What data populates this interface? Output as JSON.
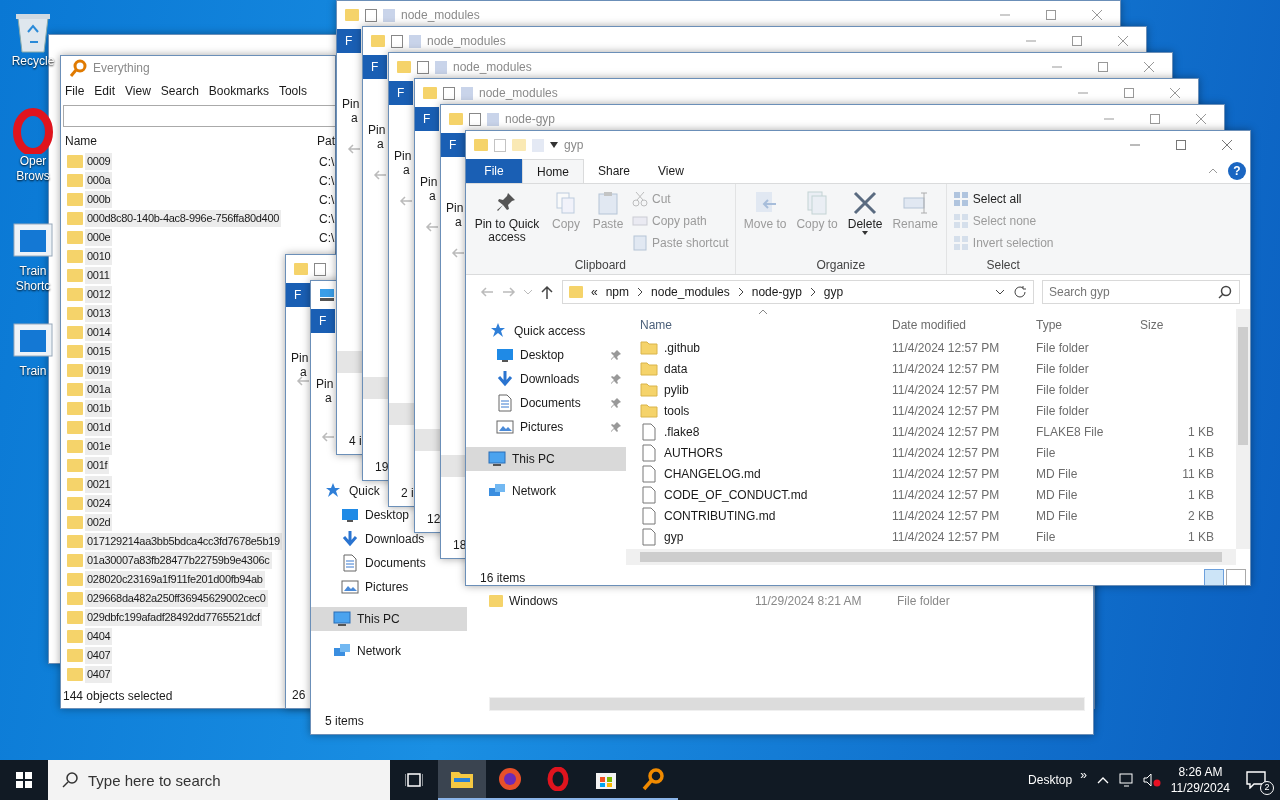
{
  "desktop_icons": [
    {
      "lines": [
        "Recycle"
      ]
    },
    {
      "lines": [
        "Oper",
        "Brows"
      ]
    },
    {
      "lines": [
        "Train",
        "Shortc"
      ]
    },
    {
      "lines": [
        "Train"
      ]
    }
  ],
  "everything_window": {
    "title": "Everything",
    "menu": [
      "File",
      "Edit",
      "View",
      "Search",
      "Bookmarks",
      "Tools"
    ],
    "columns": [
      "Name",
      "Pat"
    ],
    "rows": [
      {
        "name": "0009",
        "path": "C:\\",
        "selected": true
      },
      {
        "name": "000a",
        "path": "C:\\",
        "selected": true
      },
      {
        "name": "000b",
        "path": "C:\\",
        "selected": true
      },
      {
        "name": "000d8c80-140b-4ac8-996e-756ffa80d400",
        "path": "C:\\",
        "selected": true
      },
      {
        "name": "000e",
        "path": "C:\\",
        "selected": true
      },
      {
        "name": "0010",
        "selected": true
      },
      {
        "name": "0011",
        "selected": true
      },
      {
        "name": "0012",
        "selected": true
      },
      {
        "name": "0013",
        "selected": true
      },
      {
        "name": "0014",
        "selected": true
      },
      {
        "name": "0015",
        "selected": true
      },
      {
        "name": "0019",
        "selected": true
      },
      {
        "name": "001a",
        "selected": true
      },
      {
        "name": "001b",
        "selected": true
      },
      {
        "name": "001d",
        "selected": true
      },
      {
        "name": "001e",
        "selected": true
      },
      {
        "name": "001f",
        "selected": true
      },
      {
        "name": "0021",
        "selected": true
      },
      {
        "name": "0024",
        "selected": true
      },
      {
        "name": "002d",
        "selected": true
      },
      {
        "name": "017129214aa3bb5bdca4cc3fd7678e5b19",
        "selected": true
      },
      {
        "name": "01a30007a83fb28477b22759b9e4306c",
        "selected": true
      },
      {
        "name": "028020c23169a1f911fe201d00fb94ab",
        "selected": true
      },
      {
        "name": "029668da482a250ff36945629002cec0",
        "selected": true
      },
      {
        "name": "029dbfc199afadf28492dd7765521dcf",
        "selected": true
      },
      {
        "name": "0404",
        "selected": true
      },
      {
        "name": "0407",
        "selected": true
      },
      {
        "name": "0407",
        "selected": true
      }
    ],
    "status": "144 objects selected"
  },
  "lower_windows": [
    {
      "file_tab": "F",
      "pin_lines": [
        "Pin",
        "a"
      ],
      "status": "26"
    },
    {
      "file_tab": "F",
      "pin_lines": [
        "Pin",
        "a"
      ],
      "nav": [
        {
          "label": "Quick",
          "kind": "star",
          "selected": false
        },
        {
          "label": "Desktop",
          "kind": "desktop",
          "selected": false
        },
        {
          "label": "Downloads",
          "kind": "download",
          "selected": false
        },
        {
          "label": "Documents",
          "kind": "document",
          "selected": false
        },
        {
          "label": "Pictures",
          "kind": "picture",
          "selected": false
        },
        {
          "label": "This PC",
          "kind": "pc",
          "selected": true
        },
        {
          "label": "Network",
          "kind": "network",
          "selected": false
        }
      ],
      "row": {
        "name": "Windows",
        "date": "11/29/2024 8:21 AM",
        "type": "File folder"
      },
      "status": "5 items"
    }
  ],
  "stacked_windows": [
    {
      "title": "node_modules",
      "file_tab": "F",
      "pin_lines": [
        "Pin",
        "a"
      ],
      "status": "4 i"
    },
    {
      "title": "node_modules",
      "file_tab": "F",
      "pin_lines": [
        "Pin",
        "a"
      ],
      "status": "19"
    },
    {
      "title": "node_modules",
      "file_tab": "F",
      "pin_lines": [
        "Pin",
        "a"
      ],
      "status": "2 i"
    },
    {
      "title": "node_modules",
      "file_tab": "F",
      "pin_lines": [
        "Pin",
        "a"
      ],
      "status": "12"
    },
    {
      "title": "node-gyp",
      "file_tab": "F",
      "pin_lines": [
        "Pin",
        "a"
      ],
      "status": "18"
    }
  ],
  "explorer": {
    "title": "gyp",
    "tabs": [
      {
        "label": "File",
        "kind": "file",
        "selected": false
      },
      {
        "label": "Home",
        "kind": "tab",
        "selected": true
      },
      {
        "label": "Share",
        "kind": "tab",
        "selected": false
      },
      {
        "label": "View",
        "kind": "tab",
        "selected": false
      }
    ],
    "help": "?",
    "ribbon_groups": [
      {
        "label": "Clipboard",
        "items": [
          {
            "kind": "large",
            "label": "Pin to Quick access",
            "disabled": false
          },
          {
            "kind": "large",
            "label": "Copy",
            "disabled": true
          },
          {
            "kind": "large",
            "label": "Paste",
            "disabled": true
          },
          {
            "kind": "small",
            "label": "Cut",
            "disabled": true
          },
          {
            "kind": "small",
            "label": "Copy path",
            "disabled": true
          },
          {
            "kind": "small",
            "label": "Paste shortcut",
            "disabled": true
          }
        ]
      },
      {
        "label": "Organize",
        "items": [
          {
            "kind": "large",
            "label": "Move to",
            "disabled": true
          },
          {
            "kind": "large",
            "label": "Copy to",
            "disabled": true
          },
          {
            "kind": "large",
            "label": "Delete",
            "disabled": false
          },
          {
            "kind": "large",
            "label": "Rename",
            "disabled": true
          }
        ]
      },
      {
        "label": "Select",
        "items": [
          {
            "kind": "small",
            "label": "Select all",
            "disabled": false
          },
          {
            "kind": "small",
            "label": "Select none",
            "disabled": true
          },
          {
            "kind": "small",
            "label": "Invert selection",
            "disabled": true
          }
        ]
      }
    ],
    "breadcrumbs": [
      "«",
      "npm",
      "node_modules",
      "node-gyp",
      "gyp"
    ],
    "search": {
      "placeholder": "Search gyp"
    },
    "nav": [
      {
        "label": "Quick access",
        "kind": "star",
        "pinned": false,
        "selected": false
      },
      {
        "label": "Desktop",
        "kind": "desktop",
        "pinned": true,
        "selected": false
      },
      {
        "label": "Downloads",
        "kind": "download",
        "pinned": true,
        "selected": false
      },
      {
        "label": "Documents",
        "kind": "document",
        "pinned": true,
        "selected": false
      },
      {
        "label": "Pictures",
        "kind": "picture",
        "pinned": true,
        "selected": false
      },
      {
        "label": "This PC",
        "kind": "pc",
        "pinned": false,
        "selected": true
      },
      {
        "label": "Network",
        "kind": "network",
        "pinned": false,
        "selected": false
      }
    ],
    "columns": [
      "Name",
      "Date modified",
      "Type",
      "Size"
    ],
    "files": [
      {
        "name": ".github",
        "kind": "folder",
        "date": "11/4/2024 12:57 PM",
        "type": "File folder"
      },
      {
        "name": "data",
        "kind": "folder",
        "date": "11/4/2024 12:57 PM",
        "type": "File folder"
      },
      {
        "name": "pylib",
        "kind": "folder",
        "date": "11/4/2024 12:57 PM",
        "type": "File folder"
      },
      {
        "name": "tools",
        "kind": "folder",
        "date": "11/4/2024 12:57 PM",
        "type": "File folder"
      },
      {
        "name": ".flake8",
        "kind": "file",
        "date": "11/4/2024 12:57 PM",
        "type": "FLAKE8 File",
        "size": "1 KB"
      },
      {
        "name": "AUTHORS",
        "kind": "file",
        "date": "11/4/2024 12:57 PM",
        "type": "File",
        "size": "1 KB"
      },
      {
        "name": "CHANGELOG.md",
        "kind": "file",
        "date": "11/4/2024 12:57 PM",
        "type": "MD File",
        "size": "11 KB"
      },
      {
        "name": "CODE_OF_CONDUCT.md",
        "kind": "file",
        "date": "11/4/2024 12:57 PM",
        "type": "MD File",
        "size": "1 KB"
      },
      {
        "name": "CONTRIBUTING.md",
        "kind": "file",
        "date": "11/4/2024 12:57 PM",
        "type": "MD File",
        "size": "2 KB"
      },
      {
        "name": "gyp",
        "kind": "file",
        "date": "11/4/2024 12:57 PM",
        "type": "File",
        "size": "1 KB"
      }
    ],
    "status": "16 items"
  },
  "taskbar": {
    "search_placeholder": "Type here to search",
    "apps": [
      {
        "kind": "explorer",
        "selected": true
      },
      {
        "kind": "firefox",
        "selected": false
      },
      {
        "kind": "opera",
        "selected": false
      },
      {
        "kind": "store",
        "selected": false
      },
      {
        "kind": "everything",
        "selected": false
      }
    ],
    "toolbar_label": "Desktop",
    "overflow": "»",
    "time": "8:26 AM",
    "date": "11/29/2024",
    "notifications": "2"
  }
}
